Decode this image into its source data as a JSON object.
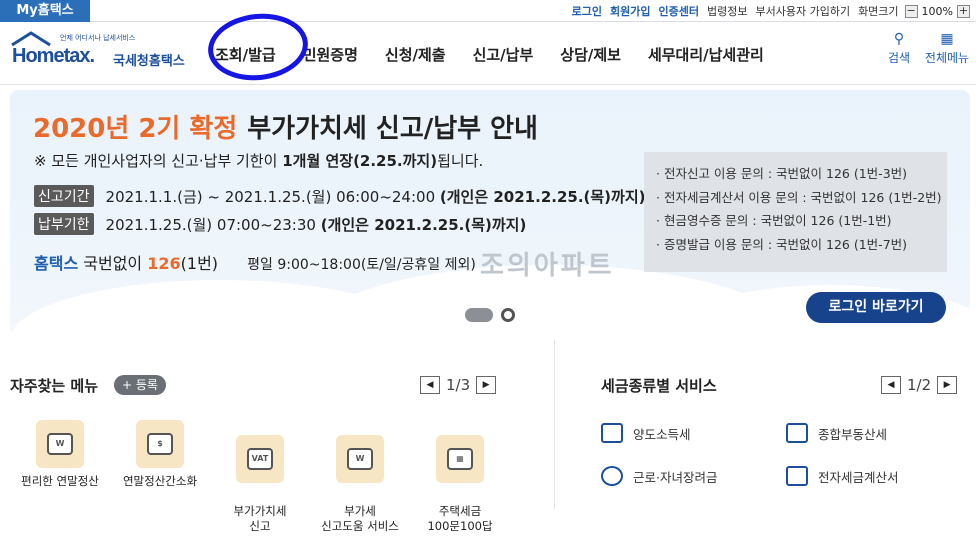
{
  "topbar": {
    "myhome": "My홈택스",
    "links": [
      "로그인",
      "회원가입",
      "인증센터"
    ],
    "links2": [
      "법령정보",
      "부서사용자 가입하기",
      "화면크기"
    ],
    "zoom_minus": "−",
    "zoom_value": "100%",
    "zoom_plus": "+"
  },
  "header": {
    "logo_text": "Hometax.",
    "logo_small": "언제 어디서나 납세서비스",
    "logo_kname": "국세청홈택스",
    "nav": [
      "조회/발급",
      "민원증명",
      "신청/제출",
      "신고/납부",
      "상담/제보",
      "세무대리/납세관리"
    ],
    "search_label": "검색",
    "allmenu_label": "전체메뉴",
    "search_icon": "search-icon",
    "allmenu_icon": "grid-icon"
  },
  "banner": {
    "title_orange": "2020년 2기 확정",
    "title_dark": "부가가치세 신고/납부 안내",
    "sub_prefix": "※ 모든 개인사업자의 신고·납부 기한이",
    "sub_bold": "1개월 연장(2.25.까지)",
    "sub_suffix": "됩니다.",
    "row1_tag": "신고기간",
    "row1_text": "2021.1.1.(금) ~ 2021.1.25.(월) 06:00~24:00",
    "row1_bold": "(개인은 2021.2.25.(목)까지)",
    "row2_tag": "납부기한",
    "row2_text": "2021.1.25.(월) 07:00~23:30",
    "row2_bold": "(개인은 2021.2.25.(목)까지)",
    "phone_brand": "홈택스",
    "phone_label": "국번없이",
    "phone_num": "126",
    "phone_ext": "(1번)",
    "hours": "평일 9:00~18:00(토/일/공휴일 제외)",
    "watermark": "조의아파트",
    "info": [
      "· 전자신고 이용 문의 : 국번없이 126 (1번-3번)",
      "· 전자세금계산서 이용 문의 : 국번없이 126 (1번-2번)",
      "· 현금영수증 문의 : 국번없이 126 (1번-1번)",
      "· 증명발급 이용 문의 : 국번없이 126 (1번-7번)"
    ],
    "login_button": "로그인 바로가기"
  },
  "favorites": {
    "title": "자주찾는 메뉴",
    "add_label": "+ 등록",
    "page": "1/3",
    "items": [
      {
        "label": "편리한 연말정산",
        "icon": "W"
      },
      {
        "label": "연말정산간소화",
        "icon": "$"
      },
      {
        "label": "부가가치세\n신고",
        "icon": "VAT"
      },
      {
        "label": "부가세\n신고도움 서비스",
        "icon": "W"
      },
      {
        "label": "주택세금\n100문100답",
        "icon": "▦"
      }
    ]
  },
  "taxservice": {
    "title": "세금종류별 서비스",
    "page": "1/2",
    "items": [
      "양도소득세",
      "종합부동산세",
      "근로·자녀장려금",
      "전자세금계산서"
    ]
  }
}
